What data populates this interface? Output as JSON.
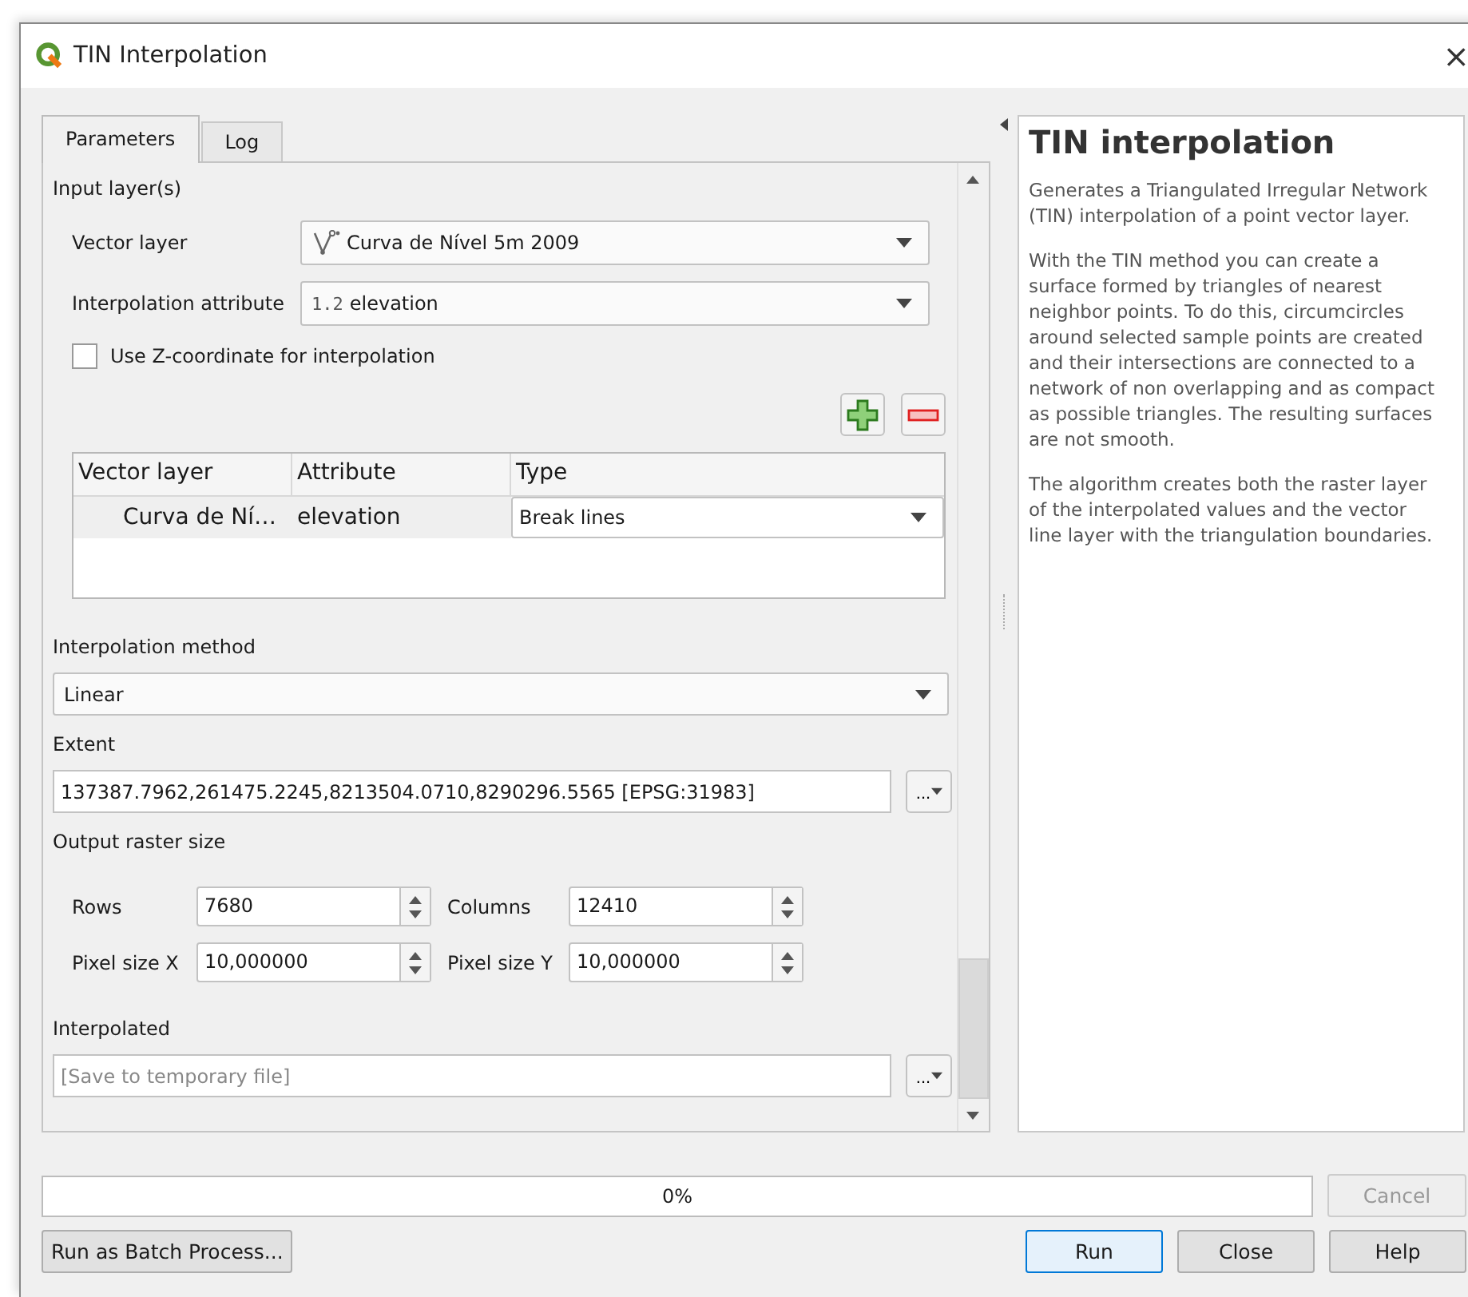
{
  "window": {
    "title": "TIN Interpolation",
    "close": "×"
  },
  "tabs": [
    {
      "label": "Parameters",
      "selected": true
    },
    {
      "label": "Log",
      "selected": false
    }
  ],
  "input_layers": {
    "heading": "Input layer(s)",
    "vector_layer": {
      "label": "Vector layer",
      "value": "Curva de Nível 5m 2009"
    },
    "interpolation_attribute": {
      "label": "Interpolation attribute",
      "type_badge": "1.2",
      "value": "elevation"
    },
    "use_z": {
      "label": "Use Z-coordinate for interpolation",
      "checked": false
    },
    "table": {
      "columns": [
        "Vector layer",
        "Attribute",
        "Type"
      ],
      "rows": [
        {
          "layer": "Curva de Ní…",
          "attribute": "elevation",
          "type": "Break lines"
        }
      ]
    }
  },
  "interpolation_method": {
    "label": "Interpolation method",
    "value": "Linear"
  },
  "extent": {
    "label": "Extent",
    "value": "137387.7962,261475.2245,8213504.0710,8290296.5565 [EPSG:31983]",
    "button": "..."
  },
  "output_raster_size": {
    "label": "Output raster size",
    "fields": [
      {
        "label": "Rows",
        "value": "7680"
      },
      {
        "label": "Columns",
        "value": "12410"
      },
      {
        "label": "Pixel size X",
        "value": "10,000000"
      },
      {
        "label": "Pixel size Y",
        "value": "10,000000"
      }
    ]
  },
  "interpolated": {
    "label": "Interpolated",
    "placeholder": "[Save to temporary file]",
    "button": "..."
  },
  "help": {
    "title": "TIN interpolation",
    "paragraphs": [
      "Generates a Triangulated Irregular Network (TIN) interpolation of a point vector layer.",
      "With the TIN method you can create a surface formed by triangles of nearest neighbor points. To do this, circumcircles around selected sample points are created and their intersections are connected to a network of non overlapping and as compact as possible triangles. The resulting surfaces are not smooth.",
      "The algorithm creates both the raster layer of the interpolated values and the vector line layer with the triangulation boundaries."
    ]
  },
  "progress": {
    "level": 0,
    "reading": "0%"
  },
  "cancel": {
    "label": "Cancel",
    "disabled": true
  },
  "footer_buttons": [
    {
      "label": "Run as Batch Process...",
      "default": false
    },
    {
      "label": "Run",
      "default": true
    },
    {
      "label": "Close",
      "default": false
    },
    {
      "label": "Help",
      "default": false
    }
  ]
}
